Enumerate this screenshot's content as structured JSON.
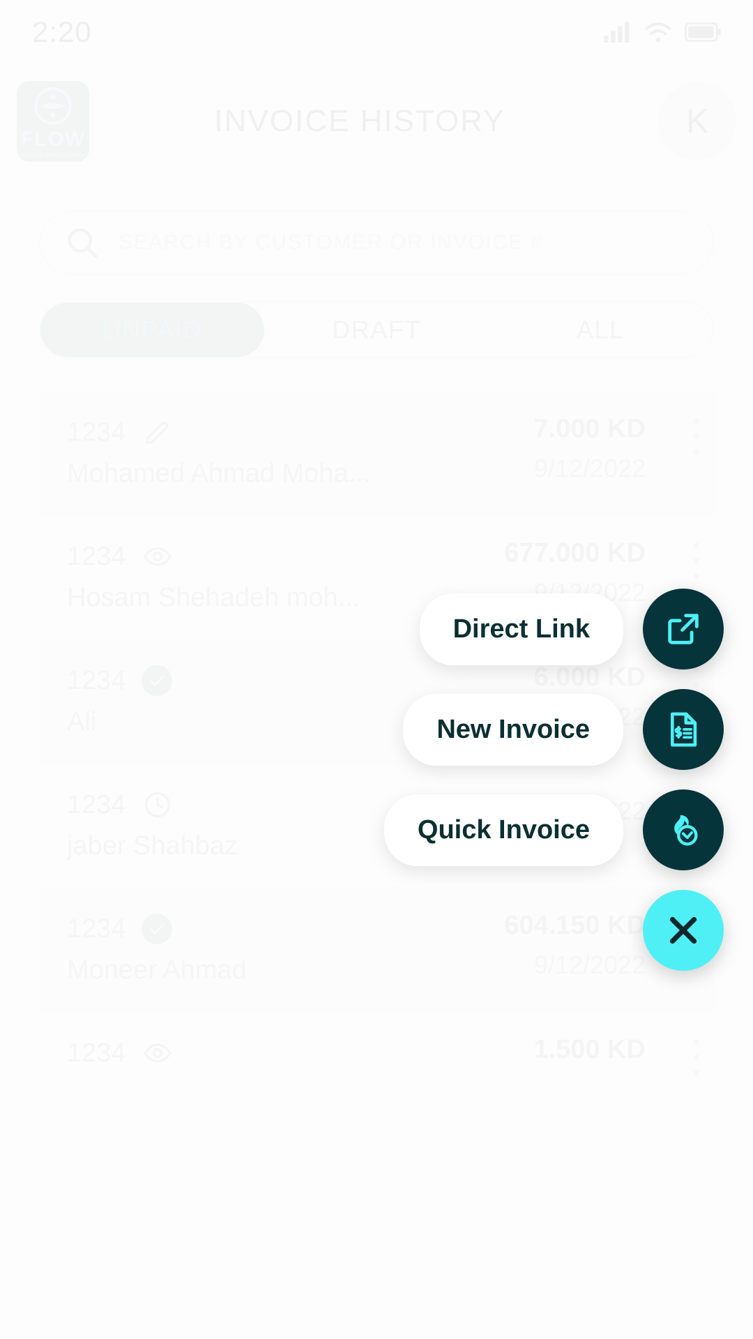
{
  "status_bar": {
    "time": "2:20",
    "icons": [
      "signal-icon",
      "wifi-icon",
      "battery-icon"
    ]
  },
  "app_bar": {
    "logo_word": "FLOW",
    "logo_subtitle": "INVOICE MANAGEMENT",
    "title": "INVOICE HISTORY",
    "avatar_initial": "K"
  },
  "search": {
    "placeholder": "SEARCH BY CUSTOMER OR INVOICE #",
    "value": "",
    "icon": "search-icon"
  },
  "tabs": [
    {
      "label": "UNPAID",
      "active": true
    },
    {
      "label": "DRAFT",
      "active": false
    },
    {
      "label": "ALL",
      "active": false
    }
  ],
  "invoices": [
    {
      "number": "1234",
      "status_icon": "pencil-icon",
      "customer": "Mohamed Ahmad Moha...",
      "amount": "7.000 KD",
      "date": "9/12/2022"
    },
    {
      "number": "1234",
      "status_icon": "eye-icon",
      "customer": "Hosam Shehadeh moh...",
      "amount": "677.000 KD",
      "date": "9/12/2022"
    },
    {
      "number": "1234",
      "status_icon": "check-circle-icon",
      "customer": "Ali",
      "amount": "6.000 KD",
      "date": "9/12/2022"
    },
    {
      "number": "1234",
      "status_icon": "clock-icon",
      "customer": "jaber Shahbaz",
      "amount": "",
      "date": "9/12/2022"
    },
    {
      "number": "1234",
      "status_icon": "check-circle-icon",
      "customer": "Moneer Ahmad",
      "amount": "604.150 KD",
      "date": "9/12/2022"
    },
    {
      "number": "1234",
      "status_icon": "eye-icon",
      "customer": "",
      "amount": "1.500 KD",
      "date": ""
    }
  ],
  "speed_dial": {
    "actions": [
      {
        "label": "Direct Link",
        "icon": "external-link-icon"
      },
      {
        "label": "New Invoice",
        "icon": "invoice-document-icon"
      },
      {
        "label": "Quick Invoice",
        "icon": "flame-clock-icon"
      }
    ],
    "close_icon": "close-icon"
  },
  "colors": {
    "accent_cyan": "#4ef0f5",
    "fab_dark": "#05343a",
    "tab_active_bg": "#b2bdbd",
    "label_text": "#0b2f33"
  }
}
